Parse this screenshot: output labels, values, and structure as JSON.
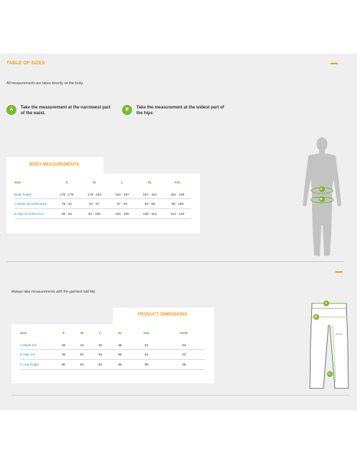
{
  "header": {
    "title": "TABLE OF SIZES"
  },
  "body_section": {
    "note": "All measurements are taken directly on the body.",
    "steps": [
      {
        "badge": "A",
        "text": "Take the measurement at the narrowest part of the waist."
      },
      {
        "badge": "B",
        "text": "Take the measurement at the widest part of the hips"
      }
    ],
    "card_title": "BODY MEASUREMENTS",
    "columns": [
      "Size",
      "S",
      "M",
      "L",
      "XL",
      "XXL"
    ],
    "rows": [
      [
        "Body height",
        "175 - 179",
        "179 - 183",
        "183 - 187",
        "187 - 191",
        "191 - 195"
      ],
      [
        "A Waist circumference",
        "75 - 81",
        "81 - 87",
        "87 - 93",
        "93 - 99",
        "99 - 105"
      ],
      [
        "B Hip circumference",
        "86 - 94",
        "94 - 100",
        "100 - 106",
        "106 - 112",
        "112 - 118"
      ]
    ],
    "figure_labels": [
      "A",
      "B"
    ]
  },
  "product_section": {
    "note": "Always take measurements with the garment laid flat.",
    "card_title": "PRODUCT DIMENSIONS",
    "columns": [
      "Size",
      "S",
      "M",
      "L",
      "XL",
      "XXL",
      "XXXL"
    ],
    "rows": [
      [
        "A Waist 1/2",
        "39",
        "42",
        "45",
        "48",
        "51",
        "54"
      ],
      [
        "B Hips 1/2",
        "49",
        "52",
        "55",
        "58",
        "61",
        "64"
      ],
      [
        "C Leg length",
        "80",
        "83",
        "84",
        "86",
        "88",
        "88"
      ]
    ],
    "figure_labels": [
      "A",
      "B",
      "C"
    ]
  },
  "colors": {
    "accent": "#f39c12",
    "blue": "#2e8fd3",
    "green": "#7cb82f",
    "panel": "#efefef"
  },
  "icons": {
    "collapse": "minus-icon"
  }
}
